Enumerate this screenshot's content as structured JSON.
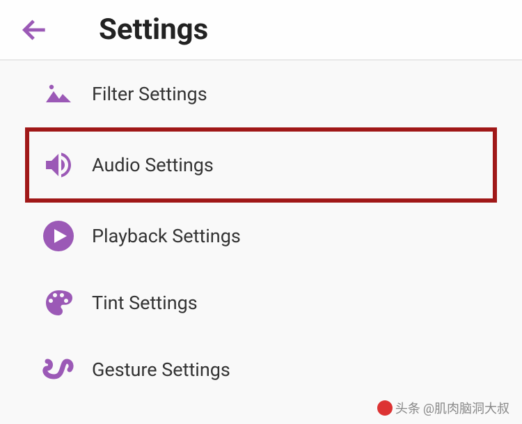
{
  "header": {
    "title": "Settings"
  },
  "items": [
    {
      "label": "Filter Settings",
      "icon": "mountains-icon",
      "highlighted": false
    },
    {
      "label": "Audio Settings",
      "icon": "speaker-icon",
      "highlighted": true
    },
    {
      "label": "Playback Settings",
      "icon": "play-icon",
      "highlighted": false
    },
    {
      "label": "Tint Settings",
      "icon": "palette-icon",
      "highlighted": false
    },
    {
      "label": "Gesture Settings",
      "icon": "squiggle-icon",
      "highlighted": false
    }
  ],
  "watermark": {
    "prefix": "头条",
    "handle": "@肌肉脑洞大叔"
  },
  "colors": {
    "accent": "#9b59b6",
    "highlight_border": "#a01818"
  }
}
